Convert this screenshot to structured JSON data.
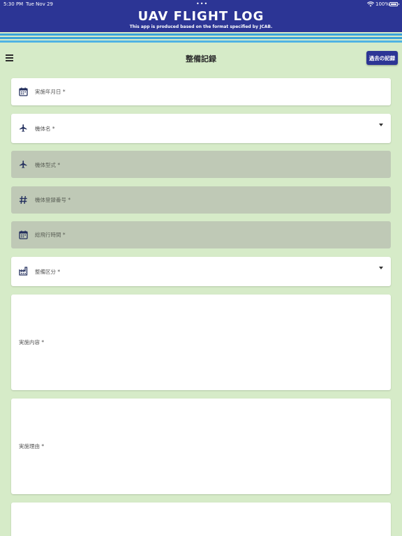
{
  "status_bar": {
    "time": "5:30 PM",
    "date": "Tue Nov 29",
    "dots": "•••",
    "battery": "100%"
  },
  "banner": {
    "title": "UAV FLIGHT LOG",
    "subtitle": "This app is produced based on the format specified by JCAB."
  },
  "toolbar": {
    "title": "整備記録",
    "history_label": "過去の記録"
  },
  "form": {
    "date": {
      "label": "実施年月日 *",
      "icon": "calendar-icon"
    },
    "aircraft_name": {
      "label": "機体名 *",
      "icon": "airplane-icon"
    },
    "aircraft_model": {
      "label": "機体型式 *",
      "icon": "airplane-icon"
    },
    "registration": {
      "label": "機体登録番号 *",
      "icon": "hash-icon"
    },
    "total_flight_time": {
      "label": "総飛行時間 *",
      "icon": "calendar-icon"
    },
    "maintenance_type": {
      "label": "整備区分 *",
      "icon": "factory-icon"
    },
    "details": {
      "label": "実施内容 *"
    },
    "reason": {
      "label": "実施理由 *"
    }
  },
  "colors": {
    "brand": "#2c3595",
    "background": "#d6ebc8",
    "disabled_field": "#bfc9b6",
    "stripe_light": "#3ba3d9"
  }
}
